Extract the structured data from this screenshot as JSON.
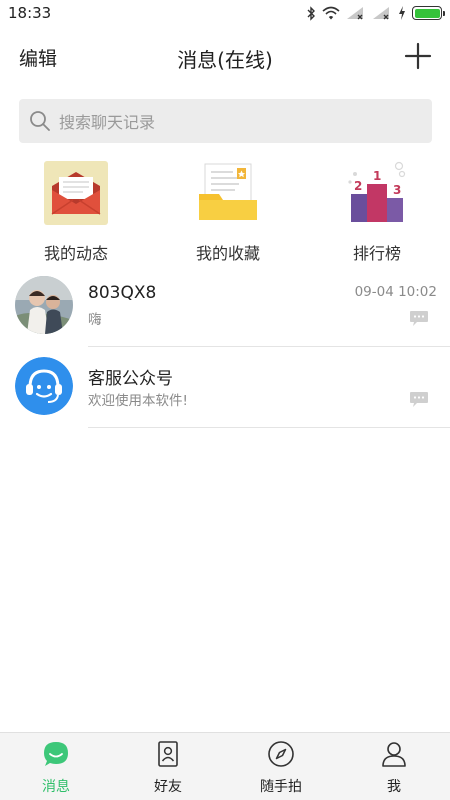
{
  "status_bar": {
    "time": "18:33",
    "battery_level": 1.0,
    "icons": [
      "bluetooth-icon",
      "wifi-icon",
      "signal-icon",
      "signal-icon",
      "charging-icon",
      "battery-icon"
    ]
  },
  "header": {
    "edit_label": "编辑",
    "title": "消息(在线)",
    "add_icon": "plus-icon"
  },
  "search": {
    "placeholder": "搜索聊天记录",
    "icon": "search-icon"
  },
  "quick_actions": [
    {
      "label": "我的动态",
      "icon": "envelope-icon"
    },
    {
      "label": "我的收藏",
      "icon": "folder-icon"
    },
    {
      "label": "排行榜",
      "icon": "podium-icon"
    }
  ],
  "chats": [
    {
      "name": "803QX8",
      "message": "嗨",
      "time": "09-04 10:02",
      "avatar": "photo-avatar"
    },
    {
      "name": "客服公众号",
      "message": "欢迎使用本软件!",
      "time": "",
      "avatar": "headset-avatar"
    }
  ],
  "tabs": [
    {
      "label": "消息",
      "icon": "message-icon",
      "active": true
    },
    {
      "label": "好友",
      "icon": "contacts-icon",
      "active": false
    },
    {
      "label": "随手拍",
      "icon": "compass-icon",
      "active": false
    },
    {
      "label": "我",
      "icon": "profile-icon",
      "active": false
    }
  ],
  "colors": {
    "accent": "#2fbf6a",
    "battery": "#35c23a",
    "service_blue": "#2f8fec",
    "search_bg": "#ececec"
  }
}
